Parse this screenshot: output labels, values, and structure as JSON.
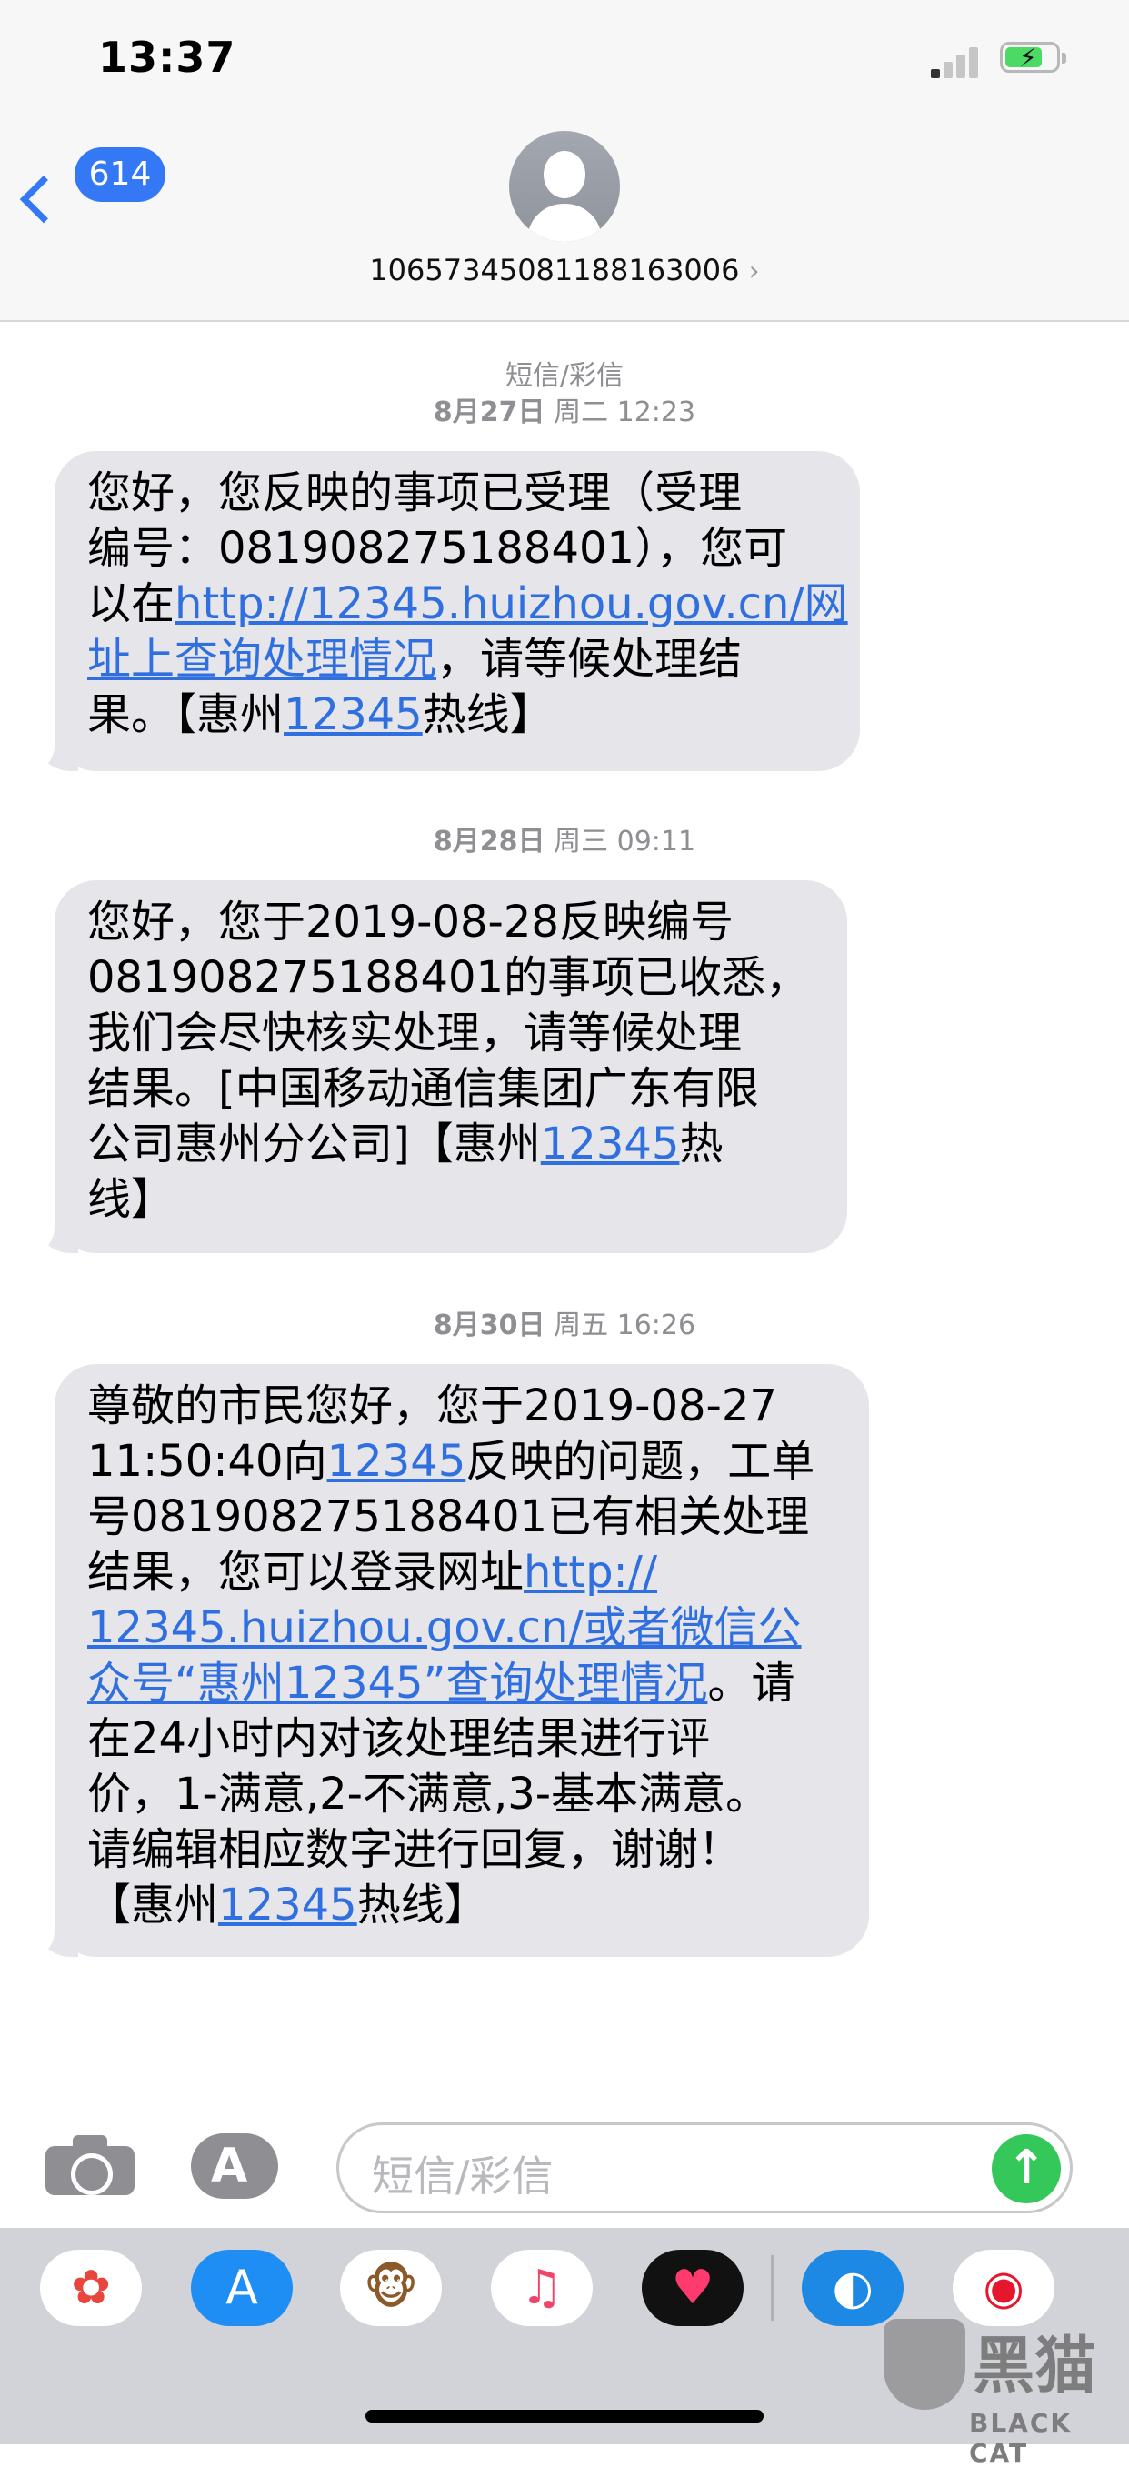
{
  "status_bar": {
    "time": "13:37"
  },
  "nav": {
    "back_count": "614",
    "contact_number": "10657345081188163006"
  },
  "conversation": {
    "service_label": "短信/彩信",
    "messages": [
      {
        "date": "8月27日",
        "day_time": " 周二 12:23",
        "lines": [
          [
            {
              "t": "您好，您反映的事项已受理（受理"
            }
          ],
          [
            {
              "t": "编号：081908275188401），您可"
            }
          ],
          [
            {
              "t": "以在"
            },
            {
              "t": "http://12345.huizhou.gov.cn/网",
              "link": true
            }
          ],
          [
            {
              "t": "址上查询处理情况",
              "link": true
            },
            {
              "t": "，请等候处理结"
            }
          ],
          [
            {
              "t": "果。【惠州"
            },
            {
              "t": "12345",
              "link": true
            },
            {
              "t": "热线】"
            }
          ]
        ]
      },
      {
        "date": "8月28日",
        "day_time": " 周三 09:11",
        "lines": [
          [
            {
              "t": "您好，您于2019-08-28反映编号"
            }
          ],
          [
            {
              "t": "081908275188401的事项已收悉，"
            }
          ],
          [
            {
              "t": "我们会尽快核实处理，请等候处理"
            }
          ],
          [
            {
              "t": "结果。[中国移动通信集团广东有限"
            }
          ],
          [
            {
              "t": "公司惠州分公司]【惠州"
            },
            {
              "t": "12345",
              "link": true
            },
            {
              "t": "热"
            }
          ],
          [
            {
              "t": "线】"
            }
          ]
        ]
      },
      {
        "date": "8月30日",
        "day_time": " 周五 16:26",
        "lines": [
          [
            {
              "t": "尊敬的市民您好，您于2019-08-27"
            }
          ],
          [
            {
              "t": "11:50:40向"
            },
            {
              "t": "12345",
              "link": true
            },
            {
              "t": "反映的问题，工单"
            }
          ],
          [
            {
              "t": "号081908275188401已有相关处理"
            }
          ],
          [
            {
              "t": "结果，您可以登录网址"
            },
            {
              "t": "http://",
              "link": true
            }
          ],
          [
            {
              "t": "12345.huizhou.gov.cn/或者微信公",
              "link": true
            }
          ],
          [
            {
              "t": "众号“惠州12345”查询处理情况",
              "link": true
            },
            {
              "t": "。请"
            }
          ],
          [
            {
              "t": "在24小时内对该处理结果进行评"
            }
          ],
          [
            {
              "t": "价，1-满意,2-不满意,3-基本满意。"
            }
          ],
          [
            {
              "t": "请编辑相应数字进行回复，谢谢！"
            }
          ],
          [
            {
              "t": "【惠州"
            },
            {
              "t": "12345",
              "link": true
            },
            {
              "t": "热线】"
            }
          ]
        ]
      }
    ]
  },
  "input_bar": {
    "placeholder": "短信/彩信"
  },
  "app_strip": {
    "apps": [
      {
        "name": "photos-app-icon",
        "glyph": "✿",
        "bg": "#ffffff",
        "fg": "#e8453c"
      },
      {
        "name": "app-store-app-icon",
        "glyph": "A",
        "bg": "#1e8ef5",
        "fg": "#ffffff"
      },
      {
        "name": "animoji-app-icon",
        "glyph": "🐵",
        "bg": "#ffffff",
        "fg": "#8b5a2b"
      },
      {
        "name": "music-app-icon",
        "glyph": "♫",
        "bg": "#ffffff",
        "fg": "#f0446b"
      },
      {
        "name": "digital-touch-app-icon",
        "glyph": "♥",
        "bg": "#111111",
        "fg": "#ff3b6e"
      },
      {
        "name": "dolphin-app-icon",
        "glyph": "◐",
        "bg": "#1e88e5",
        "fg": "#ffffff"
      },
      {
        "name": "weibo-app-icon",
        "glyph": "◉",
        "bg": "#ffffff",
        "fg": "#e6162d"
      }
    ]
  },
  "watermark": {
    "main": "黑猫",
    "sub": "BLACK CAT"
  }
}
